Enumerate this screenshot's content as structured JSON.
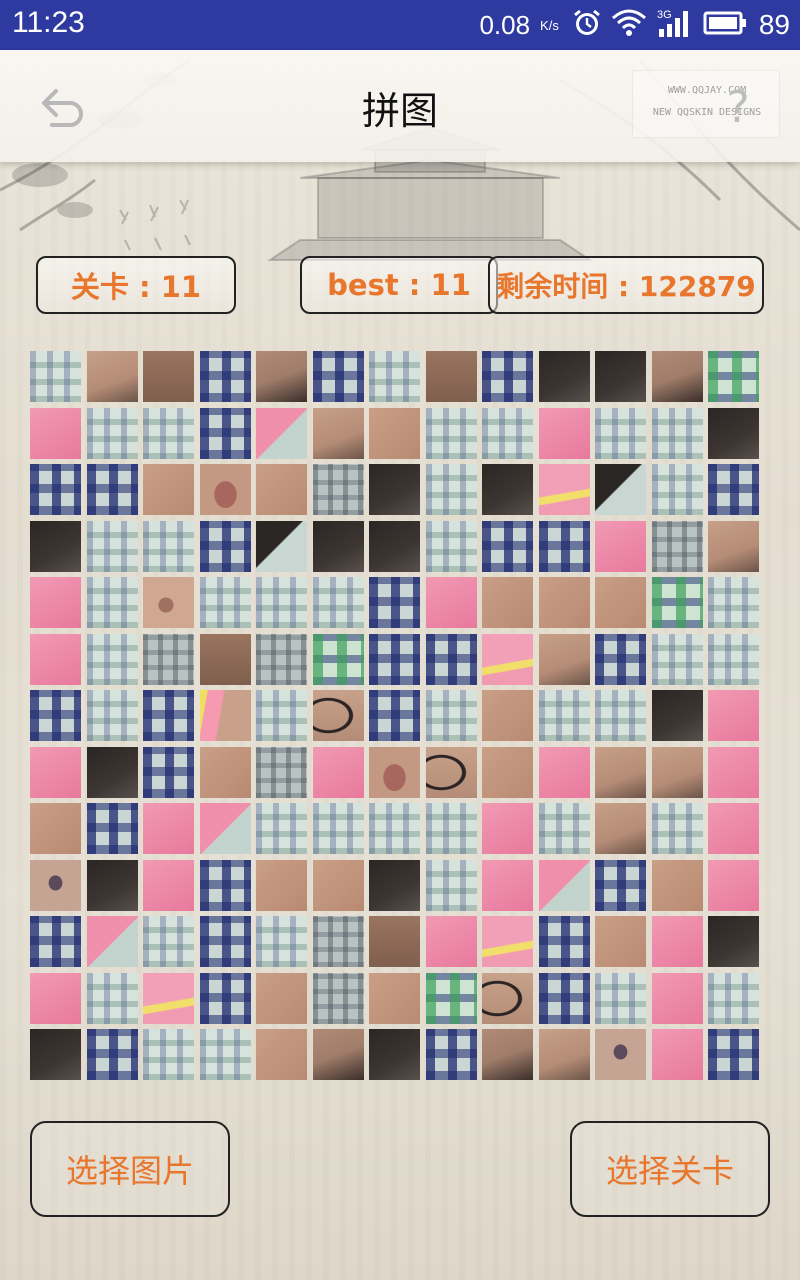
{
  "status_bar": {
    "time": "11:23",
    "net_speed": "0.08",
    "net_unit": "K/s",
    "network_type": "3G",
    "battery": "89",
    "icons": [
      "alarm-icon",
      "wifi-icon",
      "signal-icon",
      "battery-icon"
    ]
  },
  "header": {
    "title": "拼图",
    "back_icon": "back-arrow-icon",
    "help_icon": "question-mark-icon",
    "help_label": "?",
    "watermark": [
      "WWW.QQJAY.COM",
      "NEW QQSKIN DESIGNS"
    ]
  },
  "info": {
    "level_label": "关卡 : 11",
    "best_label": "best : 11",
    "time_label": "剩余时间 : 122879"
  },
  "puzzle": {
    "rows": 13,
    "cols": 13,
    "tile_kinds": [
      "plaid-light",
      "skin-face",
      "skin-brown",
      "plaid-navy",
      "skin-hair",
      "plaid-navy",
      "plaid-light",
      "skin-brown",
      "plaid-navy",
      "hair-dark",
      "hair-dark",
      "skin-hair",
      "plaid-green",
      "pink",
      "plaid-light",
      "plaid-light",
      "plaid-navy",
      "pink-plaid",
      "skin-face",
      "skin",
      "plaid-light",
      "plaid-light",
      "pink",
      "plaid-light",
      "plaid-light",
      "hair-dark",
      "plaid-navy",
      "plaid-navy",
      "skin",
      "skin-lip",
      "skin",
      "plaid-grey",
      "hair-dark",
      "plaid-light",
      "hair-dark",
      "pink-yellow",
      "hair-plaid",
      "plaid-light",
      "plaid-navy",
      "hair-dark",
      "plaid-light",
      "plaid-light",
      "plaid-navy",
      "hair-plaid",
      "hair-dark",
      "hair-dark",
      "plaid-light",
      "plaid-navy",
      "plaid-navy",
      "pink",
      "plaid-grey",
      "skin-face",
      "pink",
      "plaid-light",
      "skin-nose",
      "plaid-light",
      "plaid-light",
      "plaid-light",
      "plaid-navy",
      "pink",
      "skin",
      "skin",
      "skin",
      "plaid-green",
      "plaid-light",
      "pink",
      "plaid-light",
      "plaid-grey",
      "skin-brown",
      "plaid-grey",
      "plaid-green",
      "plaid-navy",
      "plaid-navy",
      "pink-yellow",
      "skin-face",
      "plaid-navy",
      "plaid-light",
      "plaid-light",
      "plaid-navy",
      "plaid-light",
      "plaid-navy",
      "skin-yellow",
      "plaid-light",
      "glasses",
      "plaid-navy",
      "plaid-light",
      "skin",
      "plaid-light",
      "plaid-light",
      "hair-dark",
      "pink",
      "pink",
      "hair-dark",
      "plaid-navy",
      "skin",
      "plaid-grey",
      "pink",
      "skin-lip",
      "glasses",
      "skin",
      "pink",
      "skin-face",
      "skin-face",
      "pink",
      "skin",
      "plaid-navy",
      "pink",
      "pink-plaid",
      "plaid-light",
      "plaid-light",
      "plaid-light",
      "plaid-light",
      "pink",
      "plaid-light",
      "skin-face",
      "plaid-light",
      "pink",
      "skin-eye",
      "hair-dark",
      "pink",
      "plaid-navy",
      "skin",
      "skin",
      "hair-dark",
      "plaid-light",
      "pink",
      "pink-plaid",
      "plaid-navy",
      "skin",
      "pink",
      "plaid-navy",
      "pink-plaid",
      "plaid-light",
      "plaid-navy",
      "plaid-light",
      "plaid-grey",
      "skin-brown",
      "pink",
      "pink-yellow",
      "plaid-navy",
      "skin",
      "pink",
      "hair-dark",
      "pink",
      "plaid-light",
      "pink-yellow",
      "plaid-navy",
      "skin",
      "plaid-grey",
      "skin",
      "plaid-green",
      "glasses",
      "plaid-navy",
      "plaid-light",
      "pink",
      "plaid-light",
      "hair-dark",
      "plaid-navy",
      "plaid-light",
      "plaid-light",
      "skin",
      "skin-hair",
      "hair-dark",
      "plaid-navy",
      "skin-hair",
      "skin-face",
      "skin-eye",
      "pink",
      "plaid-navy"
    ]
  },
  "buttons": {
    "pick_image": "选择图片",
    "pick_level": "选择关卡"
  },
  "colors": {
    "accent": "#e8762c",
    "status_bar": "#2e3aa0",
    "border": "#222222"
  }
}
